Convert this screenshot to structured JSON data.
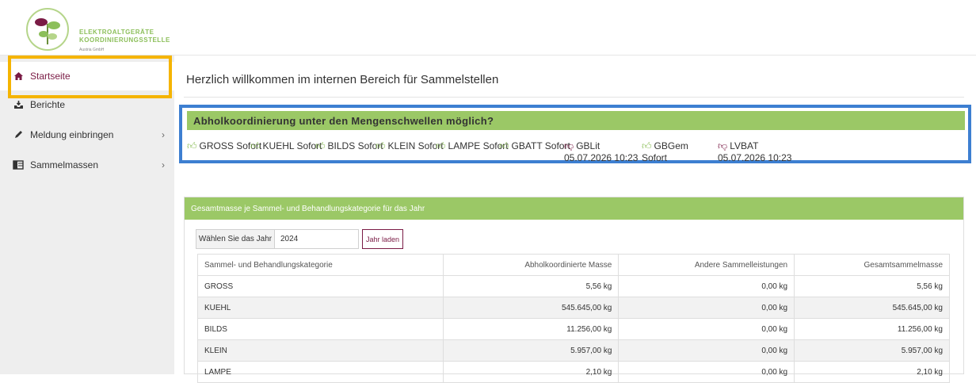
{
  "brand": {
    "name_line1": "ELEKTROALTGERÄTE",
    "name_line2": "KOORDINIERUNGSSTELLE",
    "sub": "Austria GmbH",
    "color": "#8cbf5a"
  },
  "sidebar": {
    "items": [
      {
        "label": "Startseite",
        "icon": "home-icon",
        "active": true
      },
      {
        "label": "Berichte",
        "icon": "inbox-download-icon"
      },
      {
        "label": "Meldung einbringen",
        "icon": "pencil-icon",
        "chevron": "›"
      },
      {
        "label": "Sammelmassen",
        "icon": "columns-icon",
        "chevron": "›"
      }
    ]
  },
  "welcome": "Herzlich willkommen im internen Bereich für Sammelstellen",
  "pickup": {
    "title": "Abholkoordinierung unter den Mengenschwellen möglich?",
    "items": [
      {
        "code": "GROSS",
        "status": "Sofort",
        "ok": true
      },
      {
        "code": "KUEHL",
        "status": "Sofort",
        "ok": true
      },
      {
        "code": "BILDS",
        "status": "Sofort",
        "ok": true
      },
      {
        "code": "KLEIN",
        "status": "Sofort",
        "ok": true
      },
      {
        "code": "LAMPE",
        "status": "Sofort",
        "ok": true
      },
      {
        "code": "GBATT",
        "status": "Sofort",
        "ok": true
      },
      {
        "code": "GBLit",
        "status": "05.07.2026 10:23",
        "ok": false
      },
      {
        "code": "GBGem",
        "status": "Sofort",
        "ok": true
      },
      {
        "code": "LVBAT",
        "status": "05.07.2026 10:23",
        "ok": false
      }
    ],
    "colors": {
      "ok": "#8cbf5a",
      "not_ok": "#7a1b45",
      "header": "#9bc866",
      "border": "#3d7fd1"
    }
  },
  "mass_panel": {
    "title": "Gesamtmasse je Sammel- und Behandlungskategorie für das Jahr",
    "year_label": "Wählen Sie das Jahr",
    "year_value": "2024",
    "load_button": "Jahr laden",
    "columns": [
      "Sammel- und Behandlungskategorie",
      "Abholkoordinierte Masse",
      "Andere Sammelleistungen",
      "Gesamtsammelmasse"
    ],
    "rows": [
      [
        "GROSS",
        "5,56 kg",
        "0,00 kg",
        "5,56 kg"
      ],
      [
        "KUEHL",
        "545.645,00 kg",
        "0,00 kg",
        "545.645,00 kg"
      ],
      [
        "BILDS",
        "11.256,00 kg",
        "0,00 kg",
        "11.256,00 kg"
      ],
      [
        "KLEIN",
        "5.957,00 kg",
        "0,00 kg",
        "5.957,00 kg"
      ],
      [
        "LAMPE",
        "2,10 kg",
        "0,00 kg",
        "2,10 kg"
      ]
    ]
  }
}
